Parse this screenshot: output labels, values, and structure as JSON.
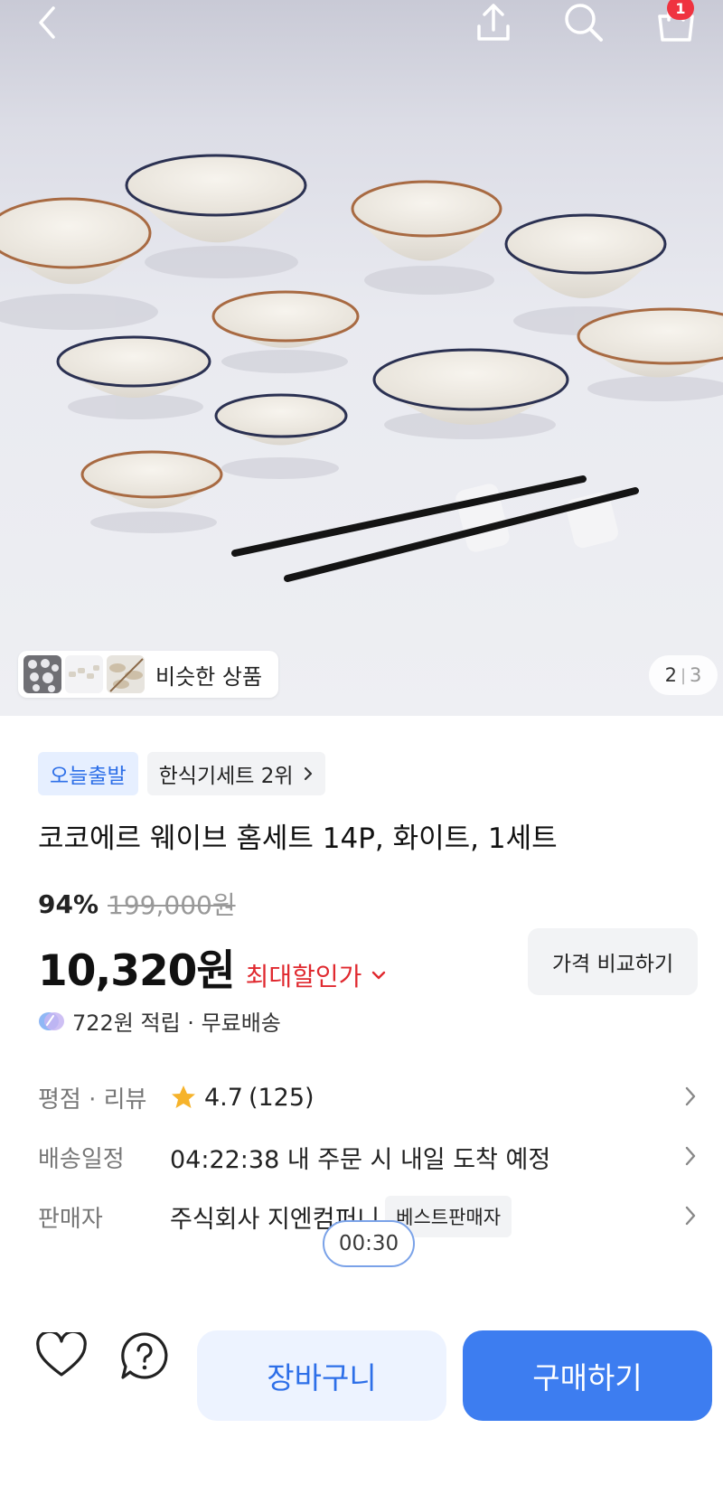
{
  "header": {
    "back_icon": "chevron-left-icon",
    "share_icon": "share-icon",
    "search_icon": "search-icon",
    "cart_icon": "shopping-bag-icon",
    "cart_count": "1"
  },
  "gallery": {
    "similar_label": "비슷한 상품",
    "current_page": "2",
    "page_separator": "|",
    "total_pages": "3"
  },
  "product": {
    "badges": {
      "today": "오늘출발",
      "rank": "한식기세트 2위"
    },
    "title": "코코에르 웨이브 홈세트 14P, 화이트, 1세트",
    "discount_percent": "94%",
    "original_price": "199,000원",
    "price": "10,320원",
    "max_discount_label": "최대할인가",
    "compare_label": "가격 비교하기",
    "reward_text": "722원 적립 · 무료배송"
  },
  "info": {
    "rating": {
      "label": "평점 · 리뷰",
      "value": "4.7",
      "count": "(125)"
    },
    "delivery": {
      "label": "배송일정",
      "value": "04:22:38 내 주문 시 내일 도착 예정"
    },
    "seller": {
      "label": "판매자",
      "value": "주식회사 지엔컴퍼니",
      "badge": "베스트판매자"
    }
  },
  "overlay": {
    "timer": "00:30"
  },
  "actions": {
    "wishlist_icon": "heart-icon",
    "inquiry_icon": "question-icon",
    "cart_label": "장바구니",
    "buy_label": "구매하기"
  },
  "colors": {
    "accent": "#3d7df0",
    "accent_light": "#edf3ff",
    "sale_red": "#e0292f",
    "badge_red": "#ef3340",
    "star": "#f6b32b"
  }
}
